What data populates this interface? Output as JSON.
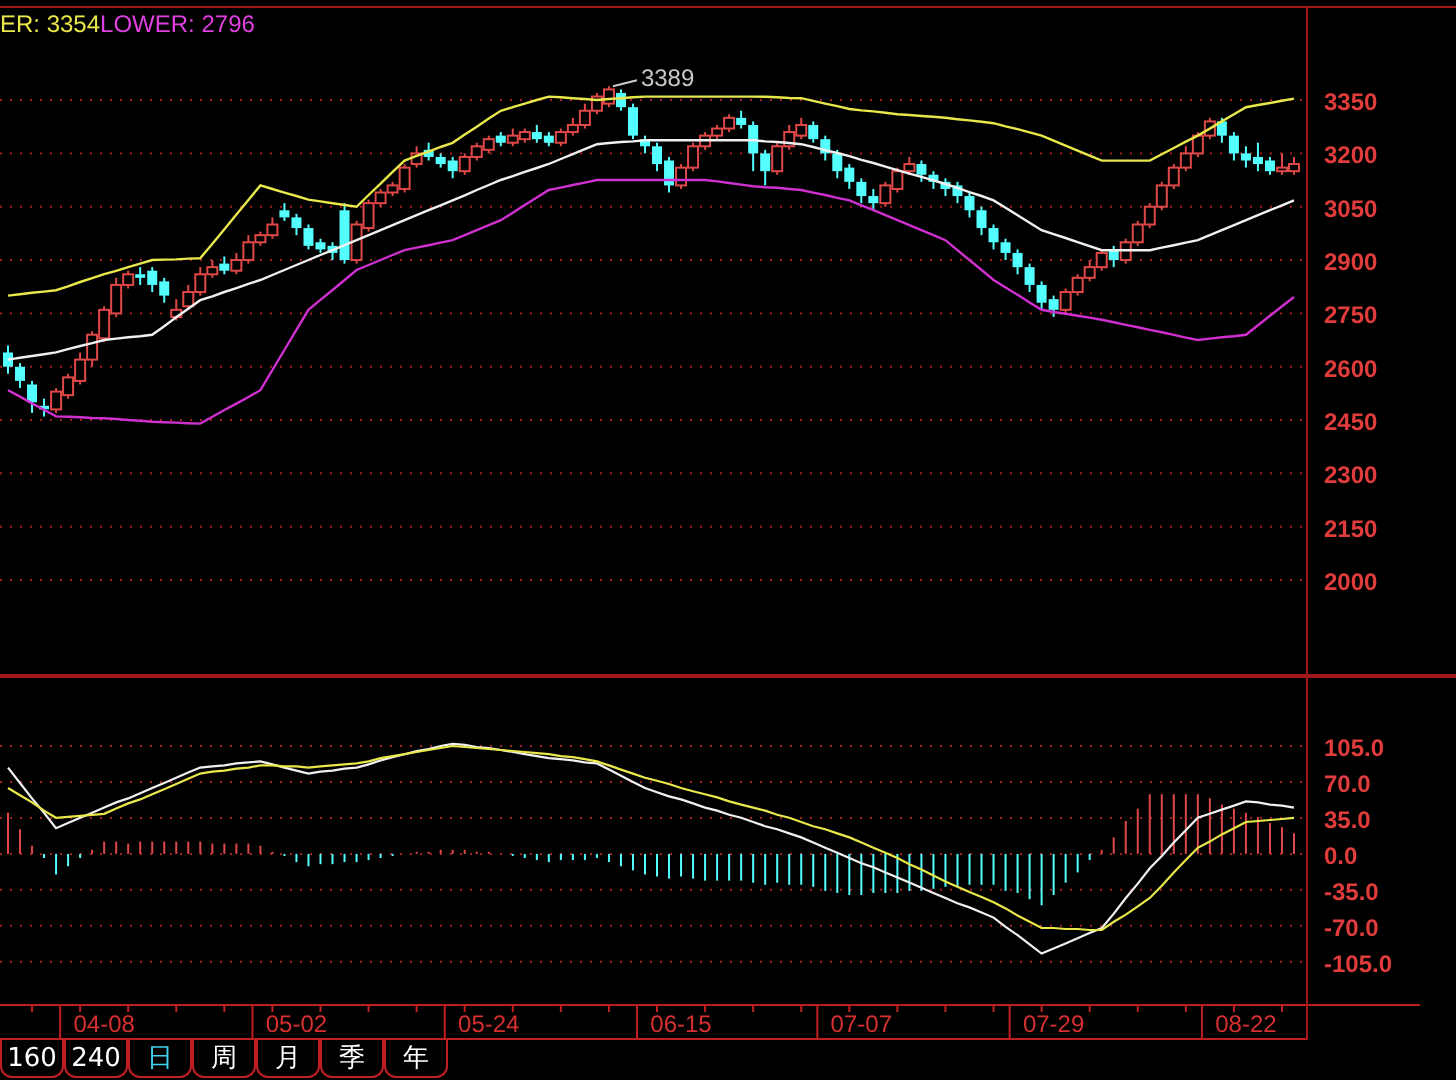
{
  "legend": [
    {
      "label": "ER: 3354",
      "color": "#e8e84a"
    },
    {
      "label": "LOWER: 2796",
      "color": "#e040e0"
    }
  ],
  "price_chart": {
    "chart_data": {
      "type": "candlestick",
      "grid": true,
      "ylim": [
        1730,
        3609
      ],
      "yticks": [
        3350,
        3200,
        3050,
        2900,
        2750,
        2600,
        2450,
        2300,
        2150,
        2000
      ],
      "categories": [
        null,
        null,
        null,
        null,
        null,
        null,
        null,
        null,
        null,
        null,
        null,
        null,
        null,
        null,
        null,
        null,
        null,
        null,
        null,
        null,
        null,
        null,
        null,
        null,
        null,
        null,
        null,
        null,
        null,
        null,
        null,
        null,
        null,
        null,
        null,
        null,
        null,
        null,
        null,
        null,
        null,
        null,
        null,
        null,
        null,
        null,
        null,
        null,
        null,
        null,
        null,
        null,
        null,
        null,
        null,
        null,
        null,
        null,
        null,
        null,
        null,
        null,
        null,
        null,
        null,
        null,
        null,
        null,
        null,
        null,
        null,
        null,
        null,
        null,
        null,
        null,
        null,
        null,
        null,
        null,
        null,
        null,
        null,
        null,
        null,
        null,
        null,
        null,
        null,
        null,
        null,
        null,
        null,
        null,
        null,
        null,
        null,
        null,
        null,
        null,
        null,
        null,
        null,
        null,
        null,
        null,
        null,
        null
      ],
      "ohlc": [
        [
          2640,
          2660,
          2580,
          2600
        ],
        [
          2600,
          2610,
          2540,
          2560
        ],
        [
          2550,
          2560,
          2470,
          2500
        ],
        [
          2490,
          2510,
          2460,
          2480
        ],
        [
          2480,
          2540,
          2470,
          2530
        ],
        [
          2520,
          2580,
          2510,
          2570
        ],
        [
          2560,
          2640,
          2550,
          2620
        ],
        [
          2620,
          2700,
          2600,
          2690
        ],
        [
          2680,
          2770,
          2670,
          2760
        ],
        [
          2750,
          2850,
          2740,
          2830
        ],
        [
          2830,
          2870,
          2820,
          2860
        ],
        [
          2860,
          2880,
          2830,
          2850
        ],
        [
          2870,
          2880,
          2810,
          2830
        ],
        [
          2840,
          2850,
          2780,
          2800
        ],
        [
          2740,
          2790,
          2730,
          2760
        ],
        [
          2770,
          2830,
          2760,
          2810
        ],
        [
          2810,
          2880,
          2800,
          2860
        ],
        [
          2860,
          2900,
          2850,
          2880
        ],
        [
          2890,
          2910,
          2860,
          2870
        ],
        [
          2870,
          2920,
          2860,
          2900
        ],
        [
          2900,
          2970,
          2890,
          2950
        ],
        [
          2950,
          2980,
          2940,
          2970
        ],
        [
          2970,
          3020,
          2960,
          3000
        ],
        [
          3040,
          3060,
          3010,
          3020
        ],
        [
          3020,
          3030,
          2970,
          2990
        ],
        [
          2990,
          3000,
          2930,
          2940
        ],
        [
          2950,
          2960,
          2920,
          2930
        ],
        [
          2940,
          2950,
          2900,
          2920
        ],
        [
          3040,
          3060,
          2890,
          2900
        ],
        [
          2900,
          3010,
          2890,
          3000
        ],
        [
          2990,
          3070,
          2980,
          3060
        ],
        [
          3060,
          3100,
          3050,
          3090
        ],
        [
          3090,
          3120,
          3080,
          3110
        ],
        [
          3100,
          3170,
          3090,
          3160
        ],
        [
          3170,
          3220,
          3160,
          3200
        ],
        [
          3210,
          3230,
          3180,
          3190
        ],
        [
          3190,
          3200,
          3160,
          3170
        ],
        [
          3180,
          3190,
          3130,
          3150
        ],
        [
          3150,
          3200,
          3140,
          3190
        ],
        [
          3190,
          3230,
          3180,
          3220
        ],
        [
          3210,
          3250,
          3200,
          3240
        ],
        [
          3250,
          3260,
          3220,
          3230
        ],
        [
          3230,
          3270,
          3220,
          3250
        ],
        [
          3240,
          3270,
          3230,
          3260
        ],
        [
          3260,
          3280,
          3230,
          3240
        ],
        [
          3250,
          3260,
          3220,
          3230
        ],
        [
          3230,
          3270,
          3220,
          3260
        ],
        [
          3260,
          3300,
          3250,
          3280
        ],
        [
          3280,
          3340,
          3270,
          3320
        ],
        [
          3320,
          3370,
          3310,
          3360
        ],
        [
          3340,
          3389,
          3330,
          3380
        ],
        [
          3370,
          3380,
          3320,
          3330
        ],
        [
          3330,
          3340,
          3240,
          3250
        ],
        [
          3240,
          3250,
          3200,
          3220
        ],
        [
          3220,
          3230,
          3150,
          3170
        ],
        [
          3180,
          3190,
          3090,
          3110
        ],
        [
          3110,
          3170,
          3100,
          3160
        ],
        [
          3160,
          3230,
          3150,
          3220
        ],
        [
          3220,
          3260,
          3210,
          3250
        ],
        [
          3250,
          3280,
          3240,
          3270
        ],
        [
          3270,
          3310,
          3260,
          3300
        ],
        [
          3300,
          3320,
          3270,
          3280
        ],
        [
          3280,
          3290,
          3150,
          3200
        ],
        [
          3200,
          3210,
          3110,
          3150
        ],
        [
          3150,
          3230,
          3140,
          3220
        ],
        [
          3220,
          3280,
          3210,
          3260
        ],
        [
          3250,
          3300,
          3240,
          3280
        ],
        [
          3280,
          3290,
          3230,
          3240
        ],
        [
          3240,
          3250,
          3180,
          3200
        ],
        [
          3200,
          3210,
          3130,
          3150
        ],
        [
          3160,
          3170,
          3100,
          3120
        ],
        [
          3120,
          3130,
          3060,
          3080
        ],
        [
          3080,
          3100,
          3040,
          3060
        ],
        [
          3060,
          3120,
          3050,
          3110
        ],
        [
          3100,
          3160,
          3090,
          3150
        ],
        [
          3150,
          3190,
          3140,
          3170
        ],
        [
          3170,
          3180,
          3120,
          3140
        ],
        [
          3140,
          3150,
          3100,
          3120
        ],
        [
          3120,
          3130,
          3080,
          3100
        ],
        [
          3110,
          3120,
          3060,
          3080
        ],
        [
          3080,
          3090,
          3020,
          3040
        ],
        [
          3040,
          3050,
          2970,
          2990
        ],
        [
          2990,
          3000,
          2930,
          2950
        ],
        [
          2950,
          2960,
          2900,
          2920
        ],
        [
          2920,
          2930,
          2860,
          2880
        ],
        [
          2880,
          2890,
          2810,
          2830
        ],
        [
          2830,
          2840,
          2760,
          2780
        ],
        [
          2790,
          2800,
          2740,
          2760
        ],
        [
          2760,
          2820,
          2750,
          2810
        ],
        [
          2810,
          2860,
          2800,
          2850
        ],
        [
          2850,
          2900,
          2840,
          2880
        ],
        [
          2880,
          2930,
          2870,
          2920
        ],
        [
          2930,
          2940,
          2880,
          2900
        ],
        [
          2900,
          2960,
          2890,
          2950
        ],
        [
          2950,
          3010,
          2940,
          3000
        ],
        [
          3000,
          3060,
          2990,
          3050
        ],
        [
          3050,
          3120,
          3040,
          3110
        ],
        [
          3110,
          3170,
          3100,
          3160
        ],
        [
          3160,
          3220,
          3150,
          3200
        ],
        [
          3200,
          3260,
          3190,
          3250
        ],
        [
          3250,
          3300,
          3240,
          3290
        ],
        [
          3290,
          3300,
          3230,
          3250
        ],
        [
          3250,
          3260,
          3180,
          3200
        ],
        [
          3200,
          3220,
          3160,
          3180
        ],
        [
          3190,
          3230,
          3150,
          3170
        ],
        [
          3180,
          3190,
          3140,
          3150
        ],
        [
          3150,
          3200,
          3140,
          3160
        ],
        [
          3150,
          3190,
          3140,
          3170
        ]
      ],
      "series": [
        {
          "type": "line",
          "color": "#e8e84a",
          "values": [
            2800,
            2804,
            2808,
            2811,
            2815,
            2826,
            2838,
            2849,
            2860,
            2870,
            2880,
            2890,
            2900,
            2901,
            2902,
            2904,
            2905,
            2946,
            2987,
            3028,
            3069,
            3110,
            3100,
            3090,
            3080,
            3070,
            3065,
            3060,
            3055,
            3050,
            3083,
            3115,
            3148,
            3180,
            3193,
            3205,
            3218,
            3230,
            3253,
            3275,
            3298,
            3320,
            3330,
            3340,
            3350,
            3360,
            3358,
            3355,
            3353,
            3350,
            3353,
            3355,
            3358,
            3360,
            3360,
            3360,
            3360,
            3360,
            3360,
            3360,
            3360,
            3360,
            3360,
            3359,
            3358,
            3356,
            3355,
            3348,
            3340,
            3333,
            3325,
            3321,
            3318,
            3314,
            3310,
            3308,
            3305,
            3303,
            3300,
            3296,
            3293,
            3289,
            3285,
            3276,
            3268,
            3259,
            3250,
            3236,
            3222,
            3208,
            3194,
            3180,
            3180,
            3180,
            3180,
            3180,
            3198,
            3215,
            3233,
            3250,
            3270,
            3290,
            3310,
            3330,
            3336,
            3342,
            3348,
            3354
          ]
        },
        {
          "type": "line",
          "color": "#f0f0f0",
          "values": [
            2620,
            2625,
            2630,
            2635,
            2640,
            2649,
            2658,
            2666,
            2675,
            2679,
            2683,
            2686,
            2690,
            2714,
            2739,
            2763,
            2787,
            2798,
            2810,
            2821,
            2833,
            2844,
            2858,
            2872,
            2886,
            2900,
            2914,
            2928,
            2942,
            2956,
            2970,
            2984,
            2998,
            3012,
            3026,
            3040,
            3054,
            3068,
            3082,
            3097,
            3111,
            3125,
            3136,
            3148,
            3159,
            3170,
            3184,
            3198,
            3212,
            3226,
            3229,
            3232,
            3234,
            3237,
            3237,
            3237,
            3237,
            3237,
            3237,
            3237,
            3237,
            3237,
            3237,
            3234,
            3232,
            3229,
            3226,
            3218,
            3209,
            3201,
            3192,
            3182,
            3173,
            3163,
            3153,
            3143,
            3134,
            3124,
            3114,
            3103,
            3091,
            3080,
            3068,
            3047,
            3026,
            3005,
            2984,
            2973,
            2962,
            2950,
            2939,
            2928,
            2928,
            2928,
            2928,
            2928,
            2935,
            2942,
            2949,
            2956,
            2970,
            2984,
            2998,
            3012,
            3026,
            3040,
            3054,
            3068
          ]
        },
        {
          "type": "line",
          "color": "#d030d0",
          "values": [
            2534,
            2516,
            2497,
            2479,
            2460,
            2459,
            2458,
            2456,
            2455,
            2453,
            2450,
            2448,
            2445,
            2444,
            2443,
            2441,
            2440,
            2459,
            2478,
            2496,
            2515,
            2534,
            2591,
            2647,
            2704,
            2760,
            2788,
            2816,
            2844,
            2872,
            2886,
            2900,
            2914,
            2928,
            2935,
            2942,
            2949,
            2956,
            2970,
            2984,
            2998,
            3012,
            3033,
            3055,
            3076,
            3097,
            3104,
            3111,
            3118,
            3125,
            3125,
            3125,
            3125,
            3125,
            3125,
            3125,
            3125,
            3125,
            3125,
            3121,
            3117,
            3112,
            3108,
            3105,
            3103,
            3100,
            3097,
            3090,
            3083,
            3075,
            3068,
            3054,
            3040,
            3026,
            3012,
            2998,
            2984,
            2970,
            2956,
            2928,
            2900,
            2872,
            2844,
            2823,
            2802,
            2781,
            2760,
            2754,
            2749,
            2743,
            2738,
            2732,
            2725,
            2718,
            2711,
            2704,
            2697,
            2690,
            2682,
            2675,
            2679,
            2683,
            2686,
            2690,
            2717,
            2743,
            2770,
            2796
          ]
        }
      ],
      "annotations": [
        {
          "text": "3389"
        }
      ]
    }
  },
  "indicator_chart": {
    "chart_data": {
      "type": "line",
      "grid": true,
      "ylim": [
        -146,
        173
      ],
      "yticks": [
        {
          "value": 105,
          "label": "105.0"
        },
        {
          "value": 70,
          "label": "70.0"
        },
        {
          "value": 35,
          "label": "35.0"
        },
        {
          "value": 0,
          "label": "0.0"
        },
        {
          "value": -35,
          "label": "-35.0"
        },
        {
          "value": -70,
          "label": "-70.0"
        },
        {
          "value": -105,
          "label": "-105.0"
        }
      ],
      "categories": [
        null,
        null,
        null,
        null,
        null,
        null,
        null,
        null,
        "04-08",
        null,
        null,
        null,
        null,
        null,
        null,
        null,
        null,
        null,
        null,
        null,
        null,
        null,
        null,
        null,
        "05-02",
        null,
        null,
        null,
        null,
        null,
        null,
        null,
        null,
        null,
        null,
        null,
        null,
        null,
        null,
        null,
        "05-24",
        null,
        null,
        null,
        null,
        null,
        null,
        null,
        null,
        null,
        null,
        null,
        null,
        null,
        null,
        null,
        "06-15",
        null,
        null,
        null,
        null,
        null,
        null,
        null,
        null,
        null,
        null,
        null,
        null,
        null,
        null,
        "07-07",
        null,
        null,
        null,
        null,
        null,
        null,
        null,
        null,
        null,
        null,
        null,
        null,
        null,
        null,
        null,
        "07-29",
        null,
        null,
        null,
        null,
        null,
        null,
        null,
        null,
        null,
        null,
        null,
        null,
        null,
        null,
        null,
        "08-22",
        null,
        null,
        null,
        null
      ],
      "series": [
        {
          "color": "#f0f0f0",
          "values": [
            84,
            69,
            54,
            40,
            25,
            30,
            35,
            40,
            45,
            50,
            54,
            59,
            64,
            69,
            74,
            79,
            84,
            85,
            86,
            88,
            89,
            90,
            87,
            84,
            81,
            78,
            80,
            81,
            83,
            84,
            87,
            91,
            94,
            97,
            100,
            102,
            105,
            107,
            106,
            104,
            103,
            101,
            99,
            97,
            95,
            93,
            92,
            91,
            89,
            88,
            82,
            76,
            70,
            64,
            60,
            56,
            53,
            49,
            45,
            42,
            38,
            35,
            31,
            27,
            24,
            20,
            16,
            11,
            6,
            1,
            -4,
            -9,
            -13,
            -18,
            -23,
            -28,
            -33,
            -38,
            -43,
            -48,
            -52,
            -57,
            -62,
            -71,
            -79,
            -88,
            -97,
            -92,
            -87,
            -82,
            -77,
            -72,
            -58,
            -43,
            -29,
            -14,
            -2,
            11,
            23,
            35,
            39,
            43,
            47,
            51,
            50,
            48,
            47,
            45
          ]
        },
        {
          "color": "#e8e84a",
          "values": [
            64,
            57,
            50,
            42,
            35,
            36,
            37,
            38,
            39,
            44,
            49,
            53,
            58,
            63,
            68,
            73,
            78,
            80,
            81,
            83,
            84,
            86,
            86,
            85,
            85,
            84,
            85,
            86,
            87,
            88,
            90,
            93,
            95,
            97,
            99,
            101,
            103,
            105,
            104,
            103,
            102,
            101,
            100,
            99,
            98,
            97,
            95,
            94,
            92,
            90,
            86,
            82,
            78,
            74,
            71,
            68,
            64,
            61,
            58,
            55,
            51,
            48,
            45,
            42,
            38,
            35,
            31,
            27,
            24,
            20,
            16,
            11,
            6,
            1,
            -4,
            -10,
            -15,
            -21,
            -27,
            -32,
            -37,
            -42,
            -47,
            -53,
            -60,
            -66,
            -72,
            -72,
            -73,
            -73,
            -74,
            -74,
            -66,
            -59,
            -51,
            -43,
            -31,
            -18,
            -6,
            6,
            12,
            19,
            25,
            31,
            32,
            33,
            34,
            35
          ]
        }
      ]
    }
  },
  "tabs": [
    {
      "label": "160",
      "selected": false
    },
    {
      "label": "240",
      "selected": false
    },
    {
      "label": "日",
      "selected": true
    },
    {
      "label": "周",
      "selected": false
    },
    {
      "label": "月",
      "selected": false
    },
    {
      "label": "季",
      "selected": false
    },
    {
      "label": "年",
      "selected": false
    }
  ]
}
